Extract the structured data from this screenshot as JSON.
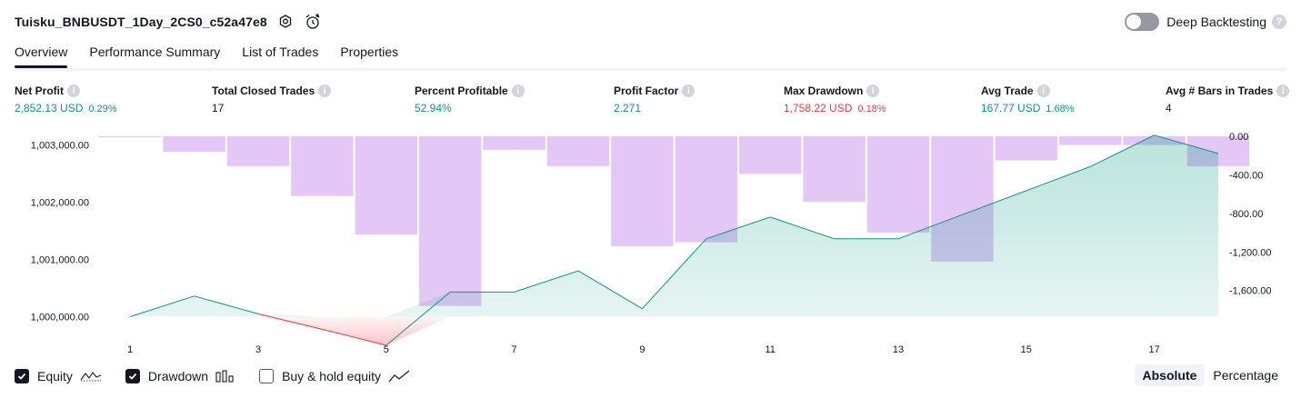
{
  "header": {
    "strategy_name": "Tuisku_BNBUSDT_1Day_2CS0_c52a47e8",
    "settings_icon": "settings-icon",
    "alert_icon": "alarm-add-icon",
    "deep_backtesting_label": "Deep Backtesting",
    "deep_backtesting_enabled": false,
    "help_icon": "question-icon"
  },
  "tabs": [
    {
      "label": "Overview",
      "active": true
    },
    {
      "label": "Performance Summary",
      "active": false
    },
    {
      "label": "List of Trades",
      "active": false
    },
    {
      "label": "Properties",
      "active": false
    }
  ],
  "metrics": [
    {
      "label": "Net Profit",
      "value": "2,852.13 USD",
      "percent": "0.29%",
      "color": "green"
    },
    {
      "label": "Total Closed Trades",
      "value": "17",
      "percent": "",
      "color": "dark"
    },
    {
      "label": "Percent Profitable",
      "value": "52.94%",
      "percent": "",
      "color": "green"
    },
    {
      "label": "Profit Factor",
      "value": "2.271",
      "percent": "",
      "color": "green"
    },
    {
      "label": "Max Drawdown",
      "value": "1,758.22 USD",
      "percent": "0.18%",
      "color": "red"
    },
    {
      "label": "Avg Trade",
      "value": "167.77 USD",
      "percent": "1.68%",
      "color": "green"
    },
    {
      "label": "Avg # Bars in Trades",
      "value": "4",
      "percent": "",
      "color": "dark"
    }
  ],
  "chart_data": {
    "type": "line+bar",
    "x_ticks": [
      "1",
      "3",
      "5",
      "7",
      "9",
      "11",
      "13",
      "15",
      "17"
    ],
    "left_axis": {
      "ticks": [
        "1,003,000.00",
        "1,002,000.00",
        "1,001,000.00",
        "1,000,000.00"
      ],
      "tick_values": [
        1003000,
        1002000,
        1001000,
        1000000
      ],
      "ylim": [
        999500,
        1003150
      ]
    },
    "right_axis": {
      "ticks": [
        "0.00",
        "-400.00",
        "-800.00",
        "-1,200.00",
        "-1,600.00"
      ],
      "tick_values": [
        0,
        -400,
        -800,
        -1200,
        -1600
      ],
      "ylim": [
        -1980,
        0
      ]
    },
    "equity": {
      "x": [
        1,
        2,
        3,
        4,
        5,
        6,
        7,
        8,
        9,
        10,
        11,
        12,
        13,
        14,
        15,
        16,
        17,
        18
      ],
      "values": [
        1000000,
        1000360,
        1000050,
        999780,
        999500,
        1000430,
        1000430,
        1000800,
        1000140,
        1001360,
        1001740,
        1001360,
        1001360,
        1001780,
        1002200,
        1002620,
        1003170,
        1002850
      ],
      "color": "#089981",
      "below_baseline_color": "#f23645",
      "fill_color": "#b2e6d6"
    },
    "drawdown": {
      "x": [
        1,
        2,
        3,
        4,
        5,
        6,
        7,
        8,
        9,
        10,
        11,
        12,
        13,
        14,
        15,
        16,
        17,
        18
      ],
      "values": [
        0,
        -160,
        -310,
        -620,
        -1020,
        -1760,
        -140,
        -310,
        -1140,
        -1100,
        -390,
        -680,
        -1000,
        -1300,
        -250,
        -90,
        -90,
        -310
      ],
      "color": "#ce93d8"
    }
  },
  "legend": {
    "items": [
      {
        "label": "Equity",
        "checked": true,
        "icon": "equity-line-icon"
      },
      {
        "label": "Drawdown",
        "checked": true,
        "icon": "drawdown-bars-icon"
      },
      {
        "label": "Buy & hold equity",
        "checked": false,
        "icon": "buy-hold-line-icon"
      }
    ]
  },
  "modes": [
    {
      "label": "Absolute",
      "active": true
    },
    {
      "label": "Percentage",
      "active": false
    }
  ]
}
